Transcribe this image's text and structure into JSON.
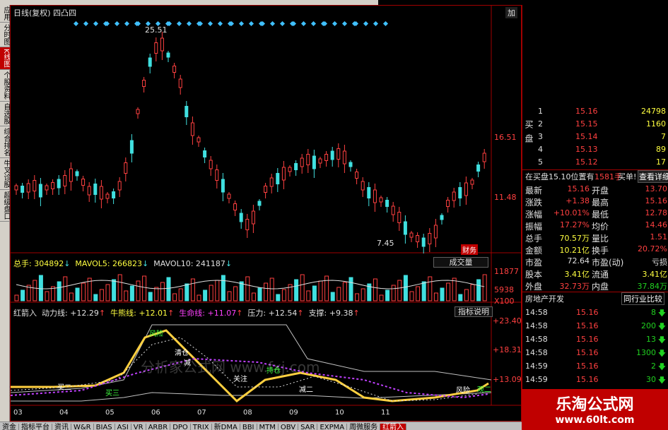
{
  "stock_title": "日线(复权) 四凸四",
  "right_corner_label": "加",
  "peak_label": "25.51",
  "low_label": "7.45",
  "price_axis": [
    "16.51",
    "11.48"
  ],
  "finance_badge": "财",
  "finance_badge2": "务",
  "vol_header": {
    "total": "总手: 304892",
    "ma5": "MAVOL5: 266823",
    "ma10": "MAVOL10: 241187",
    "button": "成交量"
  },
  "vol_axis": [
    "11877",
    "5938",
    "X100"
  ],
  "ind_header": {
    "name": "红箭入",
    "l1": "动力线: +12.29",
    "l2": "牛熊线: +12.01",
    "l3": "生命线: +11.07",
    "l4": "压力: +12.54",
    "l5": "支撑: +9.38",
    "button": "指标说明"
  },
  "ind_axis": [
    "+23.40",
    "+18.31",
    "+13.09"
  ],
  "ind_labels": [
    "风险",
    "清仓",
    "减",
    "持仓",
    "关注",
    "买二",
    "买三",
    "风险",
    "减二",
    "观二"
  ],
  "ind_watermark": "分析家公式网 www.fxj.com",
  "x_axis": [
    "03",
    "04",
    "05",
    "06",
    "07",
    "08",
    "09",
    "10",
    "11"
  ],
  "left_tabs": [
    "应用",
    "分时图",
    "K线图",
    "个股资料",
    "自选股",
    "综合排名",
    "牛叉诊股",
    "超级盘口"
  ],
  "bottom_tabs": [
    "资金",
    "指标平台",
    "资讯",
    "W&R",
    "BIAS",
    "ASI",
    "VR",
    "ARBR",
    "DPO",
    "TRIX",
    "新DMA",
    "BBI",
    "MTM",
    "OBV",
    "SAR",
    "EXPMA",
    "周微服务",
    "红箭入"
  ],
  "orderbook": {
    "side_label_buy": "买盘",
    "rows": [
      {
        "n": "1",
        "price": "15.16",
        "vol": "24798"
      },
      {
        "n": "2",
        "price": "15.15",
        "vol": "1160"
      },
      {
        "n": "3",
        "price": "15.14",
        "vol": "7"
      },
      {
        "n": "4",
        "price": "15.13",
        "vol": "89"
      },
      {
        "n": "5",
        "price": "15.12",
        "vol": "17"
      }
    ],
    "note": "在买盘15.10位置有",
    "note2": "1581手",
    "note_btn": "买单!",
    "detail_btn": "查看详细"
  },
  "quote": [
    [
      "最新",
      "15.16",
      "开盘",
      "13.70"
    ],
    [
      "涨跌",
      "+1.38",
      "最高",
      "15.16"
    ],
    [
      "涨幅",
      "+10.01%",
      "最低",
      "12.78"
    ],
    [
      "振幅",
      "17.27%",
      "均价",
      "14.46"
    ],
    [
      "总手",
      "70.57万",
      "量比",
      "1.51"
    ],
    [
      "金额",
      "10.21亿",
      "换手",
      "20.72%"
    ],
    [
      "市盈",
      "72.64",
      "市盈(动)",
      "亏损"
    ],
    [
      "股本",
      "3.41亿",
      "流通",
      "3.41亿"
    ],
    [
      "外盘",
      "32.73万",
      "内盘",
      "37.84万"
    ]
  ],
  "sector": "房地产开发",
  "sector_btn": "同行业比较",
  "ticks": [
    {
      "t": "14:58",
      "p": "15.16",
      "v": "8",
      "dir": "down"
    },
    {
      "t": "14:58",
      "p": "15.16",
      "v": "200",
      "dir": "down"
    },
    {
      "t": "14:58",
      "p": "15.16",
      "v": "13",
      "dir": "down"
    },
    {
      "t": "14:58",
      "p": "15.16",
      "v": "1300",
      "dir": "down"
    },
    {
      "t": "14:59",
      "p": "15.16",
      "v": "2",
      "dir": "down"
    },
    {
      "t": "14:59",
      "p": "15.16",
      "v": "30",
      "dir": "down"
    },
    {
      "t": "15:00",
      "p": "15.16",
      "v": "",
      "dir": ""
    }
  ],
  "site_name": "乐淘公式网",
  "site_url": "www.60lt.com",
  "colors": {
    "up": "#ff4040",
    "down": "#40e0e0",
    "accent": "#c00000"
  }
}
